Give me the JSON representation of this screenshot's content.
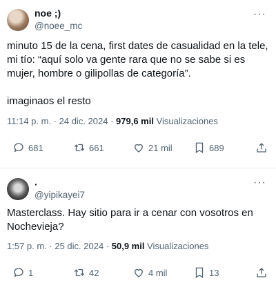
{
  "tweets": [
    {
      "name": "noe ;)",
      "handle": "@noee_mc",
      "text": "minuto 15 de la cena, first dates de casualidad en la tele, mi tío: “aquí solo va gente rara que no se sabe si es mujer, hombre o gilipollas de categoría”.\n\nimaginaos el resto",
      "time": "11:14 p. m. · 24 dic. 2024 · ",
      "views": "979,6 mil",
      "views_label": " Visualizaciones",
      "replies": "681",
      "retweets": "661",
      "likes": "21 mil",
      "bookmarks": "689"
    },
    {
      "name": "·",
      "handle": "@yipikayei7",
      "text": "Masterclass. Hay sitio para ir a cenar con vosotros en Nochevieja?",
      "time": "1:57 p. m. · 25 dic. 2024 · ",
      "views": "50,9 mil",
      "views_label": " Visualizaciones",
      "replies": "1",
      "retweets": "42",
      "likes": "4 mil",
      "bookmarks": "13"
    }
  ],
  "more_glyph": "···",
  "icons": [
    "reply-icon",
    "retweet-icon",
    "like-icon",
    "bookmark-icon",
    "share-icon"
  ]
}
